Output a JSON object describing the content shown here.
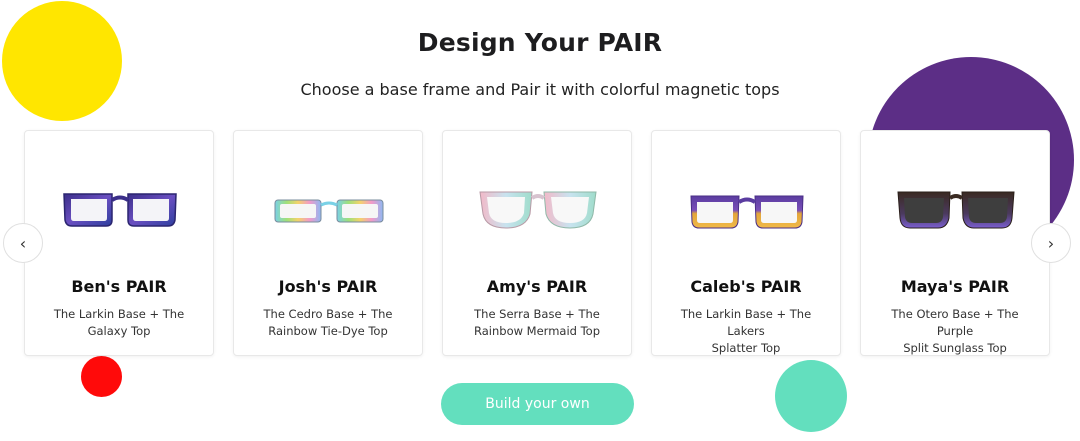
{
  "header": {
    "title": "Design Your PAIR",
    "subtitle": "Choose a base frame and Pair it with colorful magnetic tops"
  },
  "carousel": {
    "prev_icon": "‹",
    "next_icon": "›",
    "cards": [
      {
        "name": "Ben's PAIR",
        "desc_line1": "The Larkin Base + The",
        "desc_line2": "Galaxy Top"
      },
      {
        "name": "Josh's PAIR",
        "desc_line1": "The Cedro Base + The",
        "desc_line2": "Rainbow Tie-Dye Top"
      },
      {
        "name": "Amy's PAIR",
        "desc_line1": "The Serra Base + The",
        "desc_line2": "Rainbow Mermaid Top"
      },
      {
        "name": "Caleb's PAIR",
        "desc_line1": "The Larkin Base + The Lakers",
        "desc_line2": "Splatter Top"
      },
      {
        "name": "Maya's PAIR",
        "desc_line1": "The Otero Base + The Purple",
        "desc_line2": "Split Sunglass Top"
      }
    ]
  },
  "cta": {
    "label": "Build your own"
  },
  "colors": {
    "yellow": "#ffe600",
    "purple": "#5c2e86",
    "red": "#ff0a0a",
    "mint": "#63dfbe"
  }
}
